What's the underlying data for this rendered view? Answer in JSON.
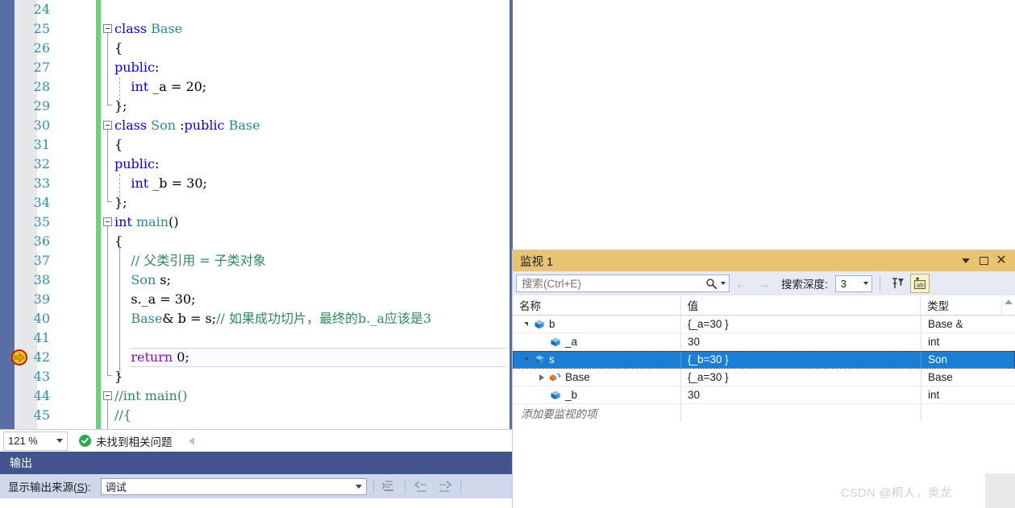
{
  "editor": {
    "zoom_level": "121 %",
    "status_text": "未找到相关问题",
    "lines": [
      {
        "num": "24",
        "text": ""
      },
      {
        "num": "25",
        "text": "class Base"
      },
      {
        "num": "26",
        "text": "{"
      },
      {
        "num": "27",
        "text": "public:"
      },
      {
        "num": "28",
        "text": "    int _a = 20;"
      },
      {
        "num": "29",
        "text": "};"
      },
      {
        "num": "30",
        "text": "class Son :public Base"
      },
      {
        "num": "31",
        "text": "{"
      },
      {
        "num": "32",
        "text": "public:"
      },
      {
        "num": "33",
        "text": "    int _b = 30;"
      },
      {
        "num": "34",
        "text": "};"
      },
      {
        "num": "35",
        "text": "int main()"
      },
      {
        "num": "36",
        "text": "{"
      },
      {
        "num": "37",
        "text": "    // 父类引用 = 子类对象"
      },
      {
        "num": "38",
        "text": "    Son s;"
      },
      {
        "num": "39",
        "text": "    s._a = 30;"
      },
      {
        "num": "40",
        "text": "    Base& b = s;// 如果成功切片，最终的b._a应该是3"
      },
      {
        "num": "41",
        "text": ""
      },
      {
        "num": "42",
        "text": "    return 0;"
      },
      {
        "num": "43",
        "text": "}"
      },
      {
        "num": "44",
        "text": "//int main()"
      },
      {
        "num": "45",
        "text": "//{"
      }
    ]
  },
  "output": {
    "title": "输出",
    "source_label_pre": "显示输出来源(",
    "source_label_key": "S",
    "source_label_post": "):",
    "source_value": "调试"
  },
  "watch": {
    "title": "监视 1",
    "search_placeholder": "搜索(Ctrl+E)",
    "depth_label": "搜索深度:",
    "depth_value": "3",
    "columns": [
      "名称",
      "值",
      "类型"
    ],
    "rows": [
      {
        "indent": 0,
        "expander": "down",
        "icon": "cube-icon",
        "name": "b",
        "value": "{_a=30 }",
        "type": "Base &",
        "selected": false
      },
      {
        "indent": 1,
        "expander": "none",
        "icon": "cube-icon",
        "name": "_a",
        "value": "30",
        "type": "int",
        "selected": false
      },
      {
        "indent": 0,
        "expander": "down",
        "icon": "cube-icon",
        "name": "s",
        "value": "{_b=30 }",
        "type": "Son",
        "selected": true
      },
      {
        "indent": 1,
        "expander": "right",
        "icon": "base-class-icon",
        "name": "Base",
        "value": "{_a=30 }",
        "type": "Base",
        "selected": false
      },
      {
        "indent": 1,
        "expander": "none",
        "icon": "cube-icon",
        "name": "_b",
        "value": "30",
        "type": "int",
        "selected": false
      }
    ],
    "add_item_text": "添加要监视的项"
  },
  "watermark": "CSDN @桐人，奥龙",
  "colors": {
    "watch_title_bg": "#e8c372",
    "selection_blue": "#1a7fd4",
    "change_bar_green": "#68d279",
    "output_title_blue": "#41558c",
    "left_strip_blue": "#5a6ea6",
    "linenum_teal": "#2b91af",
    "keyword_blue": "#0000ff",
    "comment_green": "#2e8b57",
    "type_teal": "#2b8a8a",
    "control_purple": "#8f08c4"
  }
}
